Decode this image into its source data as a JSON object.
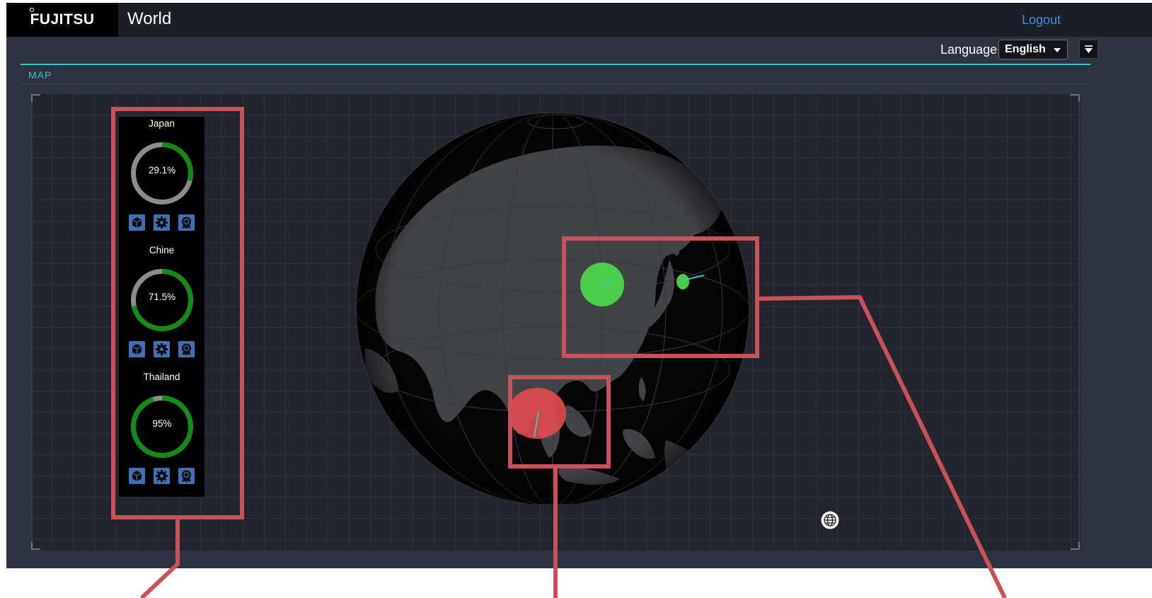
{
  "header": {
    "brand": "FUJITSU",
    "title": "World",
    "logout_label": "Logout"
  },
  "language": {
    "label": "Language",
    "selected": "English"
  },
  "map": {
    "section_label": "MAP"
  },
  "countries": [
    {
      "name": "Japan",
      "value_label": "29.1%",
      "fraction": 0.291,
      "icons": [
        "cube-icon",
        "gear-icon",
        "award-icon"
      ]
    },
    {
      "name": "Chine",
      "value_label": "71.5%",
      "fraction": 0.715,
      "icons": [
        "cube-icon",
        "gear-icon",
        "award-icon"
      ]
    },
    {
      "name": "Thailand",
      "value_label": "95%",
      "fraction": 0.95,
      "icons": [
        "cube-icon",
        "gear-icon",
        "award-icon"
      ]
    }
  ],
  "colors": {
    "accent": "#3ec4c8",
    "gauge_fill": "#158a15",
    "gauge_track": "#8c8c8c",
    "marker_ok": "#4cd44c",
    "marker_alert": "#e04b4b",
    "link": "#3c8fe6",
    "annotation": "#c9525a"
  }
}
